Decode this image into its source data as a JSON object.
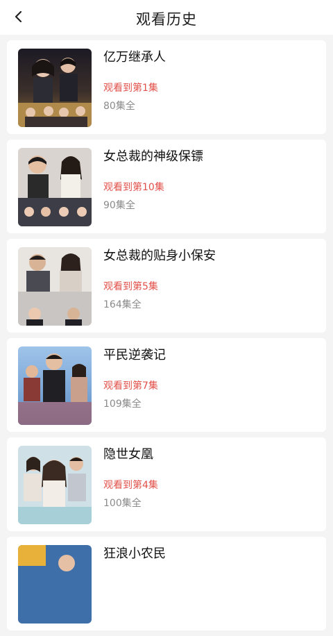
{
  "header": {
    "title": "观看历史",
    "back_icon": "chevron-left-icon"
  },
  "colors": {
    "accent": "#e2504a",
    "muted": "#8a8a8a",
    "background": "#f4f4f4"
  },
  "history": [
    {
      "title": "亿万继承人",
      "progress": "观看到第1集",
      "total": "80集全",
      "cover_text": ""
    },
    {
      "title": "女总裁的神级保镖",
      "progress": "观看到第10集",
      "total": "90集全",
      "cover_text": ""
    },
    {
      "title": "女总裁的贴身小保安",
      "progress": "观看到第5集",
      "total": "164集全",
      "cover_text": ""
    },
    {
      "title": "平民逆袭记",
      "progress": "观看到第7集",
      "total": "109集全",
      "cover_text": ""
    },
    {
      "title": "隐世女凰",
      "progress": "观看到第4集",
      "total": "100集全",
      "cover_text": ""
    },
    {
      "title": "狂浪小农民",
      "progress": "",
      "total": "",
      "cover_text": ""
    }
  ]
}
